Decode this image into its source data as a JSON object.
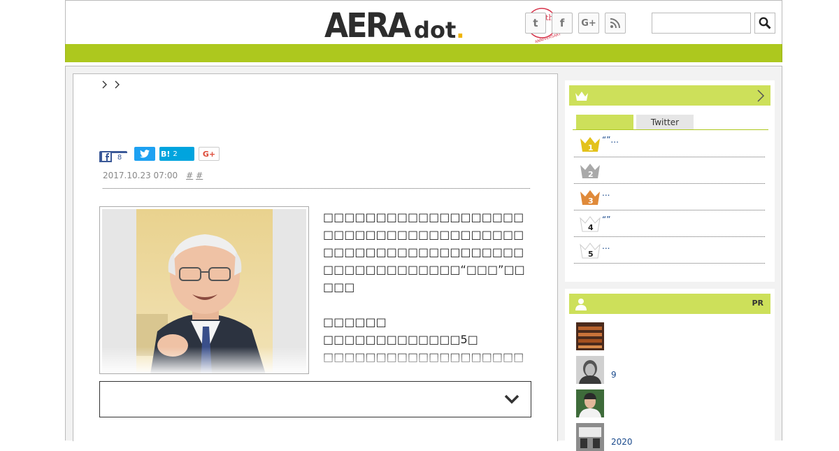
{
  "header": {
    "logo_aera": "AERA",
    "logo_dot": "dot",
    "logo_period": ".",
    "logo_anniversary": "ANNIVERSARY",
    "logo_5th_number": "5",
    "logo_5th_suffix": "th",
    "social": {
      "twitter_glyph": "t",
      "facebook_glyph": "f",
      "googleplus_glyph": "G+"
    },
    "search": {
      "value": "",
      "placeholder": ""
    }
  },
  "colors": {
    "nav_bar": "#adc81e",
    "sidebar_header": "#cde05a",
    "link": "#1a4a8c",
    "rank_gold": "#e3c21c",
    "rank_silver": "#a9a9a9",
    "rank_bronze": "#e08a3a"
  },
  "article": {
    "share": {
      "facebook_count": "8",
      "hatena_label": "B!",
      "hatena_count": "2",
      "googleplus_label": "G+"
    },
    "meta": {
      "date": "2017.10.23 07:00",
      "tag1": "#",
      "tag2": "#"
    },
    "body": [
      "□□□□□□□□□□□□□□□□□□□□□□□□□□□□□□□□□□□□□□□□□□□□□□□□□□□□□□□□□□□□□□□□□□□□□□“□□□”□□□□□",
      "□□□□□□",
      "□□□□□□□□□□□□□5□",
      "□□□□□□□□□□□□□□□□□□□□□□",
      "□□□□□□□□□□□□□□□□□□□□□□□□□"
    ]
  },
  "ranking": {
    "tabs": [
      "",
      "Twitter"
    ],
    "items": [
      {
        "rank": "1",
        "title": "“”..."
      },
      {
        "rank": "2",
        "title": ""
      },
      {
        "rank": "3",
        "title": "..."
      },
      {
        "rank": "4",
        "title": "“”"
      },
      {
        "rank": "5",
        "title": "..."
      }
    ]
  },
  "pr": {
    "label": "PR",
    "items": [
      {
        "text": ""
      },
      {
        "text": "9"
      },
      {
        "text": ""
      },
      {
        "text": "2020"
      }
    ]
  }
}
